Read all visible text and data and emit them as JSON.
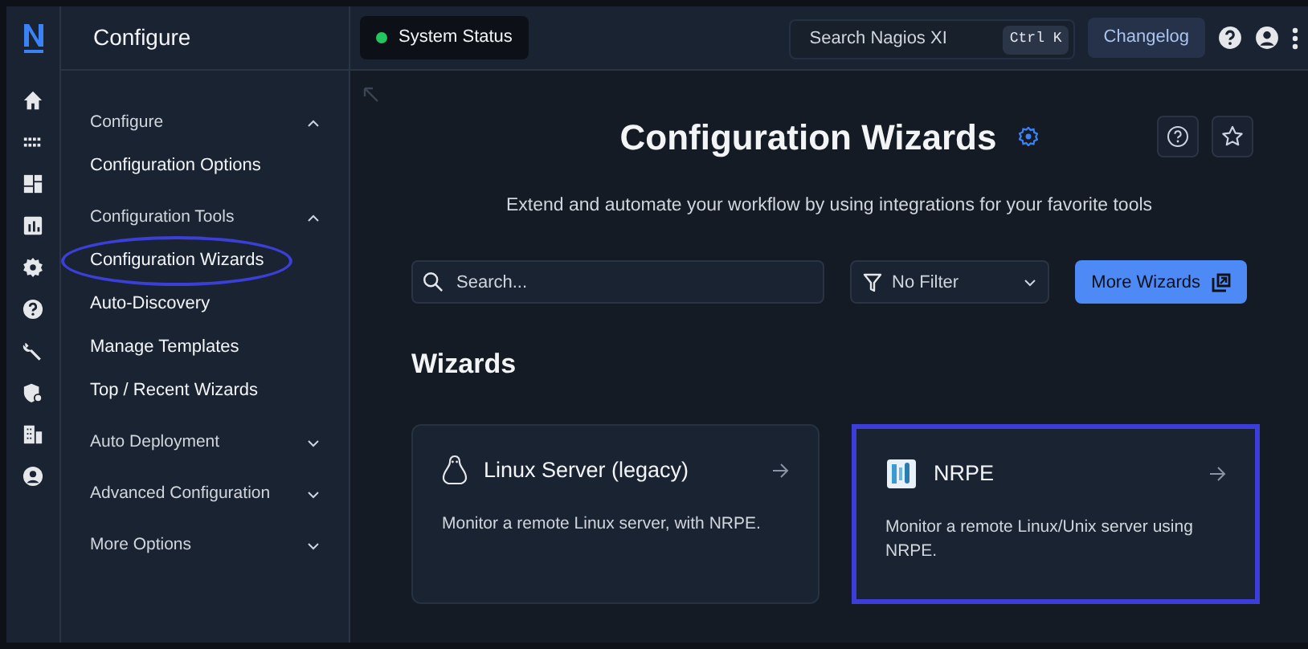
{
  "sidebar": {
    "title": "Configure",
    "sections": [
      {
        "label": "Configure",
        "expanded": true,
        "items": [
          {
            "label": "Configuration Options",
            "highlighted": false
          }
        ]
      },
      {
        "label": "Configuration Tools",
        "expanded": true,
        "items": [
          {
            "label": "Configuration Wizards",
            "highlighted": true
          },
          {
            "label": "Auto-Discovery",
            "highlighted": false
          },
          {
            "label": "Manage Templates",
            "highlighted": false
          },
          {
            "label": "Top / Recent Wizards",
            "highlighted": false
          }
        ]
      },
      {
        "label": "Auto Deployment",
        "expanded": false
      },
      {
        "label": "Advanced Configuration",
        "expanded": false
      },
      {
        "label": "More Options",
        "expanded": false
      }
    ]
  },
  "topbar": {
    "status": {
      "label": "System Status",
      "color": "#22c55e"
    },
    "search": {
      "placeholder": "Search Nagios XI",
      "shortcut": "Ctrl K"
    },
    "changelog": "Changelog"
  },
  "page": {
    "title": "Configuration Wizards",
    "subtitle": "Extend and automate your workflow by using integrations for your favorite tools",
    "search": {
      "placeholder": "Search..."
    },
    "filter": {
      "value": "No Filter"
    },
    "more_button": "More Wizards",
    "section_title": "Wizards",
    "wizards": [
      {
        "kind": "linux",
        "title": "Linux Server (legacy)",
        "description": "Monitor a remote Linux server, with NRPE.",
        "highlighted": false
      },
      {
        "kind": "nrpe",
        "title": "NRPE",
        "description": "Monitor a remote Linux/Unix server using NRPE.",
        "highlighted": true
      }
    ]
  }
}
